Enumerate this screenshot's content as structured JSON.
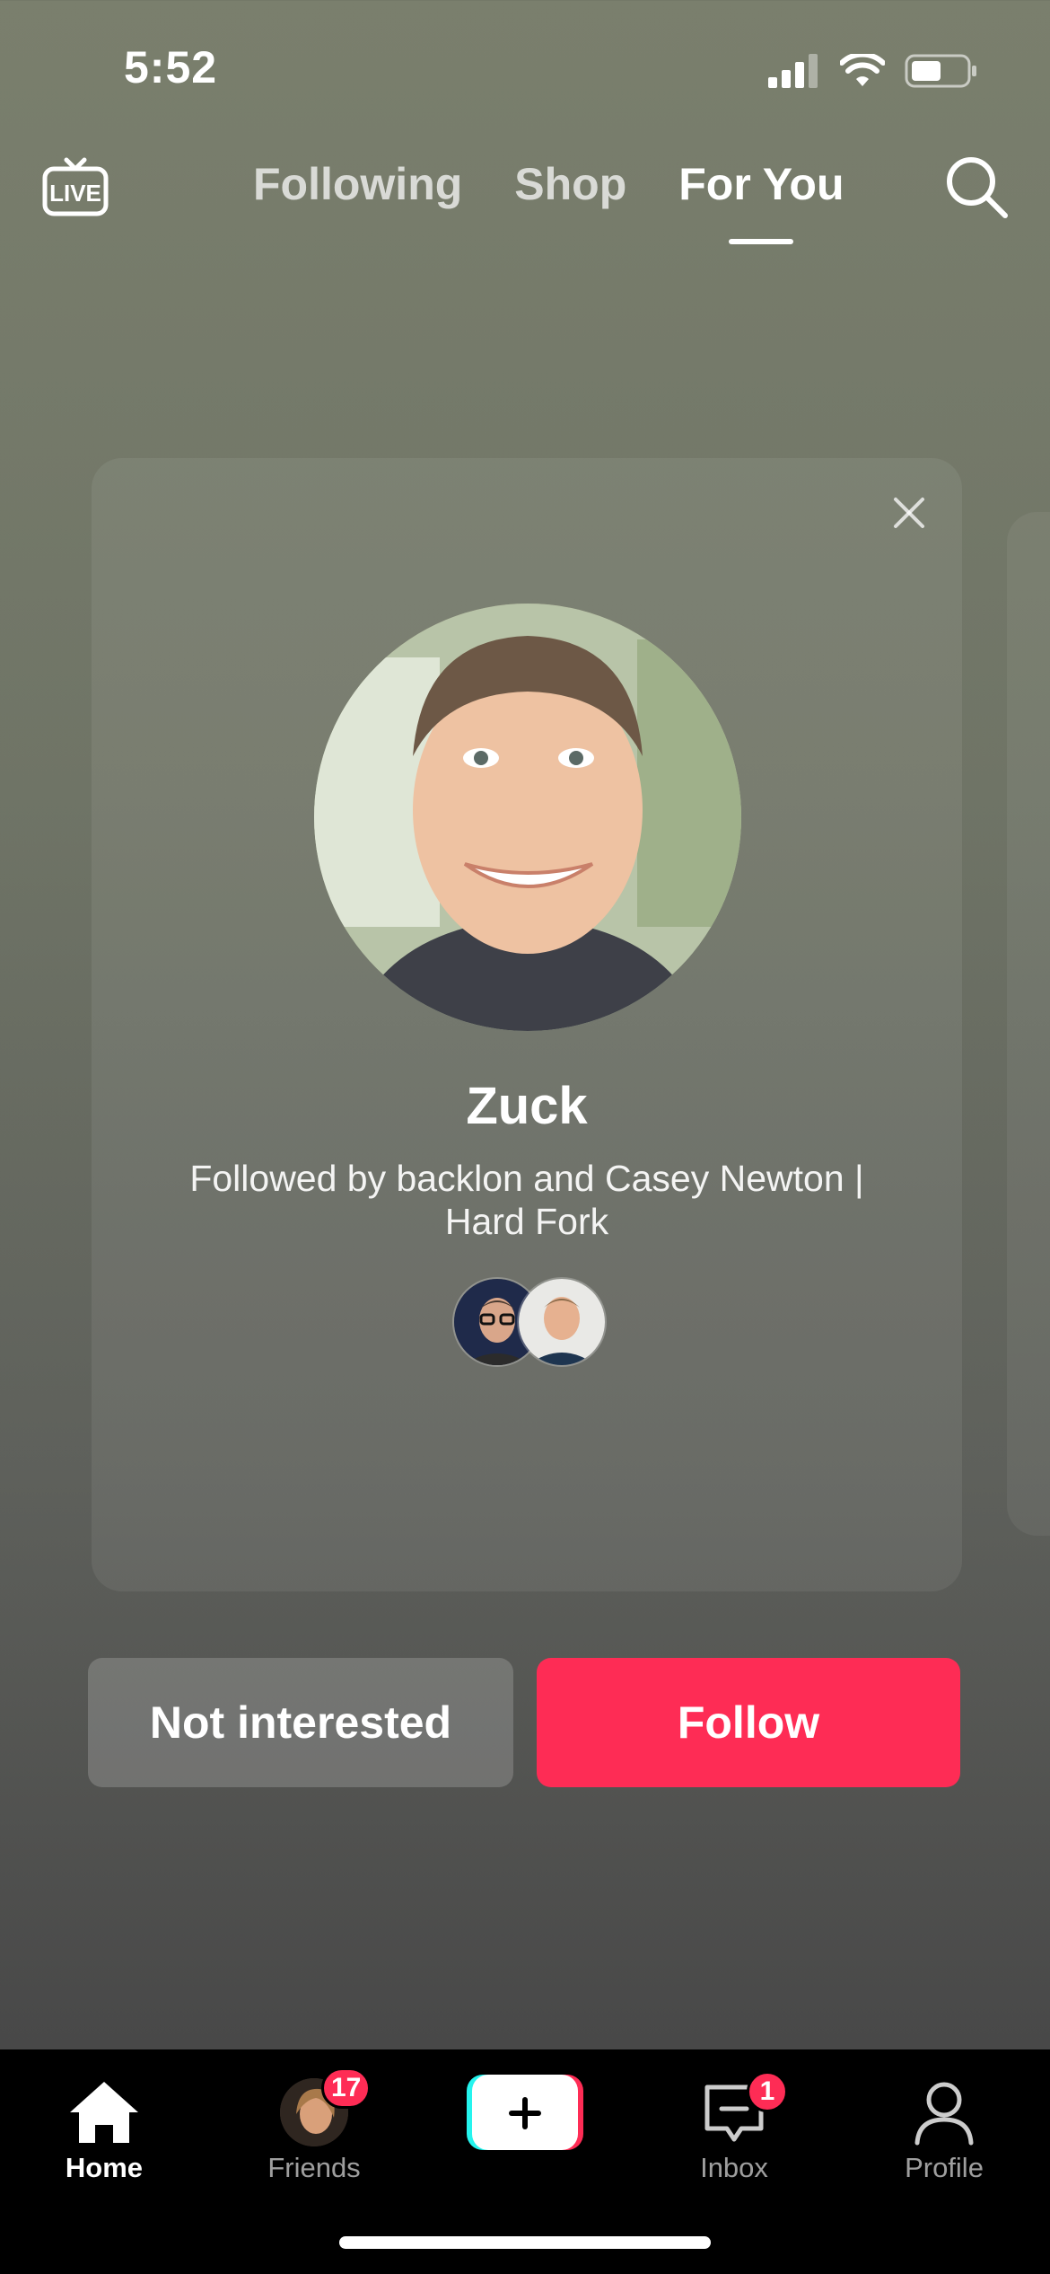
{
  "status_bar": {
    "time": "5:52"
  },
  "top_nav": {
    "live_icon": "live-tv-icon",
    "tabs": [
      {
        "label": "Following",
        "active": false
      },
      {
        "label": "Shop",
        "active": false
      },
      {
        "label": "For You",
        "active": true
      }
    ],
    "search_icon": "search-icon"
  },
  "suggestion_card": {
    "name": "Zuck",
    "followed_by": "Followed by backlon and Casey Newton | Hard Fork",
    "close_icon": "close-icon"
  },
  "actions": {
    "not_interested_label": "Not interested",
    "follow_label": "Follow",
    "follow_color": "#fe2c55"
  },
  "bottom_tabs": {
    "home": {
      "label": "Home",
      "icon": "home-icon",
      "active": true
    },
    "friends": {
      "label": "Friends",
      "badge": "17"
    },
    "create": {
      "icon": "plus-icon"
    },
    "inbox": {
      "label": "Inbox",
      "icon": "inbox-icon",
      "badge": "1"
    },
    "profile": {
      "label": "Profile",
      "icon": "profile-icon"
    }
  }
}
